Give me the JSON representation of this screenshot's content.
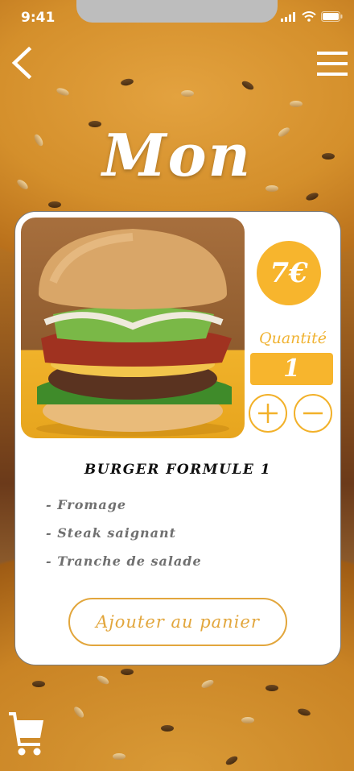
{
  "status_bar": {
    "time": "9:41"
  },
  "header": {
    "title": "Mon"
  },
  "product": {
    "price": "7€",
    "quantity_label": "Quantité",
    "quantity": "1",
    "name": "BURGER FORMULE 1",
    "ingredients": [
      "- Fromage",
      "- Steak saignant",
      "- Tranche de salade"
    ],
    "add_to_cart_label": "Ajouter au panier"
  },
  "colors": {
    "accent": "#f7b52d",
    "card_bg": "#ffffff",
    "text_muted": "#707070"
  },
  "icons": {
    "back": "chevron-left-icon",
    "menu": "hamburger-menu-icon",
    "plus": "plus-icon",
    "minus": "minus-icon",
    "cart": "shopping-cart-icon"
  }
}
